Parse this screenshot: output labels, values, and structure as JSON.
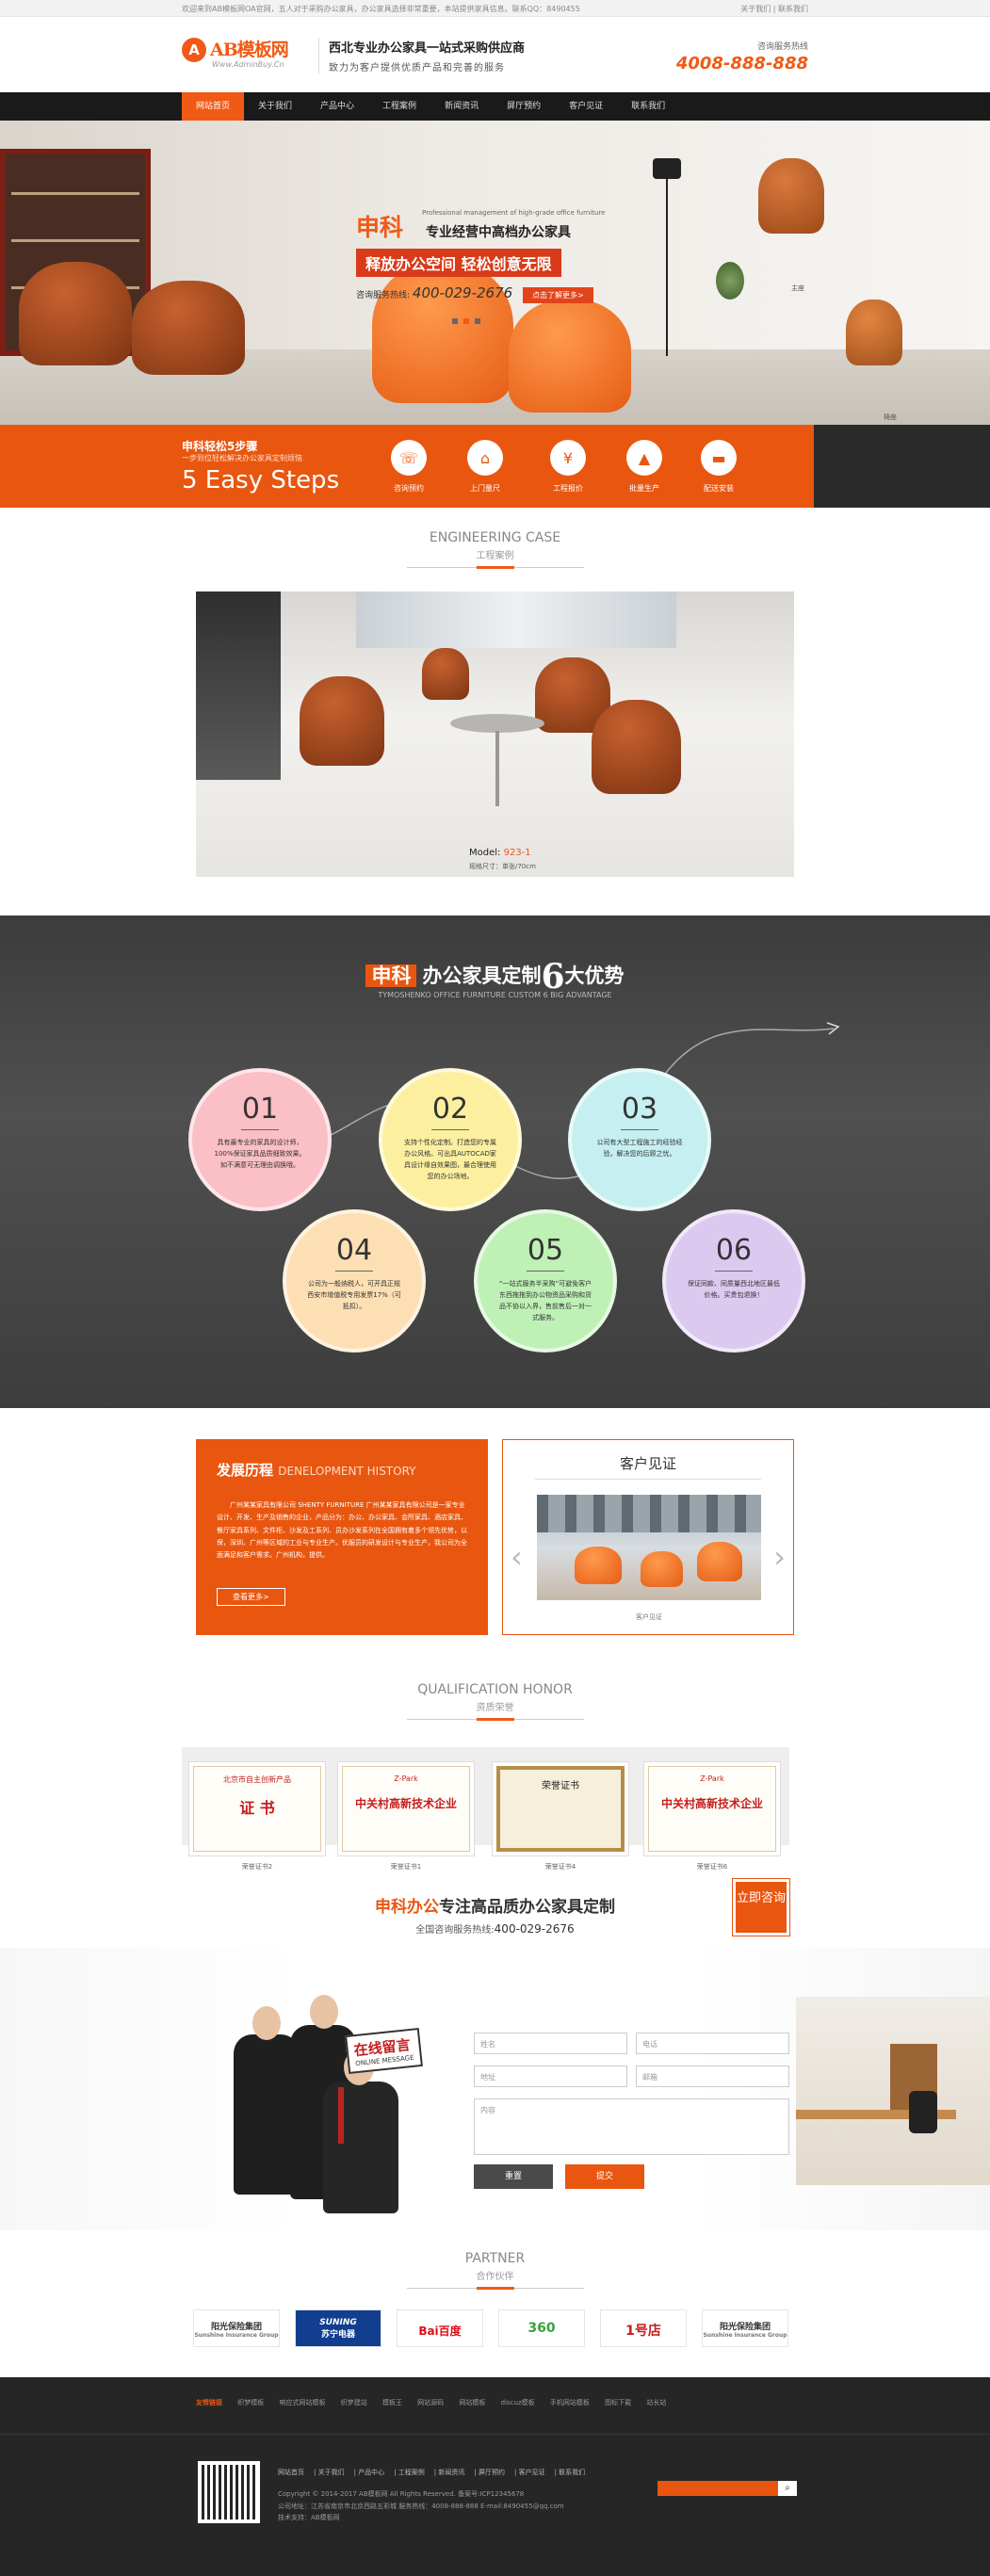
{
  "topbar": {
    "left": "欢迎来到AB模板网OA官网，五人对于采购办公家具，办公家具选择非常重要，本站提供家具信息。联系QQ：8490455",
    "right": "关于我们  |  联系我们"
  },
  "header": {
    "logo_badge": "A",
    "logo_name": "AB模板网",
    "logo_url": "Www.AdminBuy.Cn",
    "slogan_main": "西北专业办公家具一站式采购供应商",
    "slogan_sub": "致力为客户提供优质产品和完善的服务",
    "hotline_label": "咨询服务热线",
    "hotline_number": "4008-888-888"
  },
  "nav": {
    "items": [
      "网站首页",
      "关于我们",
      "产品中心",
      "工程案例",
      "新闻资讯",
      "屏厅预约",
      "客户见证",
      "联系我们"
    ]
  },
  "banner": {
    "brand": "申科",
    "en_line": "Professional management of high-grade office furniture",
    "headline": "专业经营中高档办公家具",
    "red_line": "释放办公空间 轻松创意无限",
    "tel_label": "咨询服务热线:",
    "tel_number": "400-029-2676",
    "button": "点击了解更多>",
    "product_captions": [
      "主座",
      "椅座"
    ]
  },
  "steps": {
    "title": "申科轻松5步骤",
    "subtitle": "一步到位轻松解决办公家具定制烦恼",
    "big": "5 Easy Steps",
    "items": [
      {
        "label": "咨询预约",
        "icon": "chat-icon"
      },
      {
        "label": "上门量尺",
        "icon": "ruler-icon"
      },
      {
        "label": "工程报价",
        "icon": "price-icon"
      },
      {
        "label": "批量生产",
        "icon": "factory-icon"
      },
      {
        "label": "配送安装",
        "icon": "truck-icon"
      }
    ]
  },
  "engineering": {
    "en": "ENGINEERING CASE",
    "cn": "工程案例",
    "model_label": "Model:",
    "model_value": "923-1",
    "size": "规格尺寸：单张/70cm"
  },
  "advantage": {
    "tag": "申科",
    "title_a": "办公家具定制",
    "six": "6",
    "title_b": "大优势",
    "sub": "TYMOSHENKO OFFICE FURNITURE CUSTOM 6 BIG ADVANTAGE",
    "items": [
      {
        "num": "01",
        "text": "具有最专业的家具的设计师，100%保证家具品质细致效果。如不满意可无理由调换哦。"
      },
      {
        "num": "02",
        "text": "支持个性化定制。打造您的专属办公风格。可出具AUTOCAD家具设计缘自效果图，最合理使用您的办公场地。"
      },
      {
        "num": "03",
        "text": "公司有大型工程施工的经验经验，解决您的后顾之忧。"
      },
      {
        "num": "04",
        "text": "公司为一般纳税人，可开具正规西安市增值税专用发票17%（可抵扣）。"
      },
      {
        "num": "05",
        "text": "“一站式服务半采购”可避免客户东西拖拖到办公物资品采购和货品不协以入界，售前售后一对一式服务。"
      },
      {
        "num": "06",
        "text": "保证同款、同质量西北地区最低价格。买贵包退换！"
      }
    ]
  },
  "history": {
    "title": "发展历程",
    "title_en": "DENELOPMENT HISTORY",
    "text": "广州某某家具有限公司 SHENTY FURNITURE 广州某某家具有限公司是一家专业设计、开发、生产及销售的企业，产品分为：办公、办公家具、会所家具、酒店家具、餐厅家具系列、文件柜、沙发及工系列、员办沙发系列在全国拥有着多个领先优势，以保，深圳、广州等区域的工业与专业生产。优服员的研发设计与专业生产，我公司为全面满足和客户需求。广州机构，提供。",
    "more": "查看更多>"
  },
  "testimonial": {
    "title": "客户见证",
    "caption": "客户见证",
    "prev": "‹",
    "next": "›"
  },
  "qualification": {
    "en": "QUALIFICATION HONOR",
    "cn": "资质荣誉",
    "certs": [
      {
        "top": "北京市自主创新产品",
        "main": "证 书",
        "caption": "荣誉证书2"
      },
      {
        "top": "Z-Park",
        "main": "中关村高新技术企业",
        "caption": "荣誉证书1"
      },
      {
        "top": "荣誉证书",
        "main": "",
        "caption": "荣誉证书4"
      },
      {
        "top": "Z-Park",
        "main": "中关村高新技术企业",
        "caption": "荣誉证书6"
      }
    ]
  },
  "message": {
    "brand": "申科办公",
    "title": "专注高品质办公家具定制",
    "tel_label": "全国咨询服务热线:",
    "tel": "400-029-2676",
    "badge": "立即咨询",
    "online_cn": "在线留言",
    "online_en": "ONLINE MESSAGE",
    "fields": {
      "name": "姓名",
      "phone": "电话",
      "address": "地址",
      "email": "邮箱",
      "content": "内容"
    },
    "reset": "重置",
    "submit": "提交"
  },
  "partner": {
    "en": "PARTNER",
    "cn": "合作伙伴",
    "logos": [
      {
        "name": "阳光保险集团",
        "sub": "Sunshine Insurance Group",
        "color": "#e9560f"
      },
      {
        "name": "SUNING",
        "sub": "苏宁电器",
        "color": "#ffffff"
      },
      {
        "name": "Bai百度",
        "sub": "",
        "color": "#de0f17"
      },
      {
        "name": "360",
        "sub": "",
        "color": "#3ba33b"
      },
      {
        "name": "1号店",
        "sub": "",
        "color": "#c41d1d"
      },
      {
        "name": "阳光保险集团",
        "sub": "Sunshine Insurance Group",
        "color": "#e9560f"
      }
    ]
  },
  "footer": {
    "friend_label": "友情链接",
    "links": [
      "织梦模板",
      "响应式网站模板",
      "织梦建站",
      "模板王",
      "网站源码",
      "网站模板",
      "discuz模板",
      "手机网站模板",
      "图标下载",
      "站长站"
    ],
    "nav": [
      "网站首页",
      "关于我们",
      "产品中心",
      "工程案例",
      "新闻资讯",
      "屏厅预约",
      "客户见证",
      "联系我们"
    ],
    "copyright": "Copyright © 2014-2017 AB模板网 All Rights Reserved.    备案号:ICP12345678",
    "address": "公司地址：江苏省南京市北京西路五彩城    服务热线：4008-888-888    E-mail:8490455@qq.com",
    "support": "技术支持：AB模板网"
  },
  "colors": {
    "accent": "#e9560f",
    "dark": "#262626"
  }
}
